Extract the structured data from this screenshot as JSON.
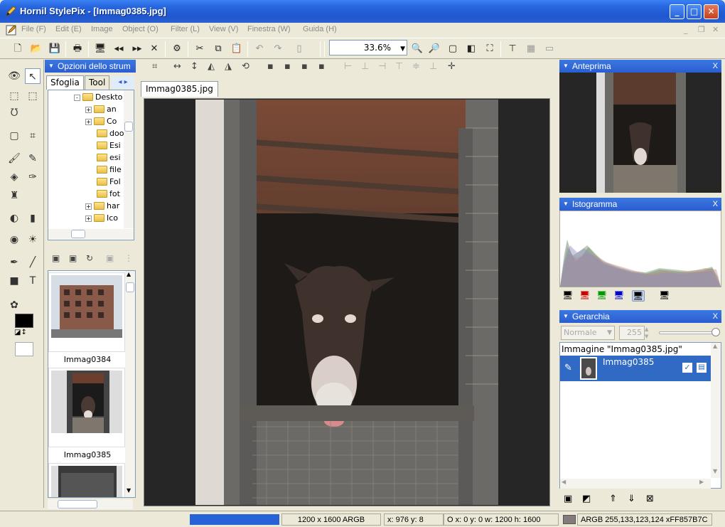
{
  "window": {
    "title": "Hornil StylePix - [Immag0385.jpg]"
  },
  "menu": [
    {
      "label": "File (F)"
    },
    {
      "label": "Edit (E)"
    },
    {
      "label": "Image"
    },
    {
      "label": "Object (O)"
    },
    {
      "label": "Filter (L)"
    },
    {
      "label": "View (V)"
    },
    {
      "label": "Finestra (W)"
    },
    {
      "label": "Guida (H)"
    }
  ],
  "toolbar": {
    "zoom": "33.6%"
  },
  "browser": {
    "header": "Opzioni dello strum",
    "tabs": [
      "Sfoglia",
      "Tool"
    ],
    "tree": [
      {
        "label": "Deskto",
        "expander": "-"
      },
      {
        "label": "an",
        "expander": "+"
      },
      {
        "label": "Co",
        "expander": "+"
      },
      {
        "label": "doo",
        "expander": ""
      },
      {
        "label": "Esi",
        "expander": ""
      },
      {
        "label": "esi",
        "expander": ""
      },
      {
        "label": "file",
        "expander": ""
      },
      {
        "label": "Fol",
        "expander": ""
      },
      {
        "label": "fot",
        "expander": ""
      },
      {
        "label": "har",
        "expander": "+"
      },
      {
        "label": "Ico",
        "expander": "+"
      }
    ],
    "thumbnails": [
      {
        "label": "Immag0384"
      },
      {
        "label": "Immag0385"
      }
    ]
  },
  "document": {
    "tab": "Immag0385.jpg"
  },
  "panels": {
    "preview": {
      "title": "Anteprima"
    },
    "histogram": {
      "title": "Istogramma"
    },
    "layers": {
      "title": "Gerarchia",
      "blend_mode": "Normale",
      "opacity": "255",
      "root": "Immagine \"Immag0385.jpg\"",
      "items": [
        {
          "name": "Immag0385"
        }
      ]
    }
  },
  "status": {
    "size": "1200 x 1600 ARGB",
    "cursor": "x: 976 y:   8",
    "selection": "O x:   0 y:   0 w: 1200 h: 1600",
    "color": "ARGB 255,133,123,124 xFF857B7C"
  },
  "colors": {
    "accent": "#316AC5",
    "titlebar": "#2766DE",
    "pixel": "#857B7C"
  }
}
